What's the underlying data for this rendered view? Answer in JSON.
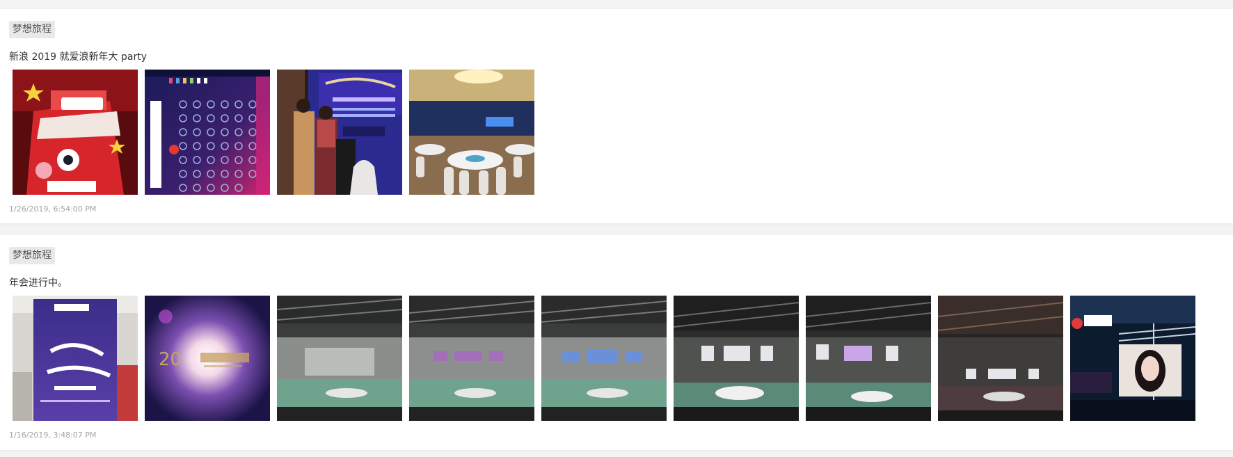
{
  "posts": [
    {
      "tag": "梦想旅程",
      "text": "新浪 2019 就爱浪新年大 party",
      "timestamp": "1/26/2019, 6:54:00 PM",
      "photos": [
        {
          "name": "cake-photo"
        },
        {
          "name": "seating-chart-photo"
        },
        {
          "name": "signin-backdrop-photo"
        },
        {
          "name": "banquet-hall-photo"
        }
      ]
    },
    {
      "tag": "梦想旅程",
      "text": "年会进行中。",
      "timestamp": "1/16/2019, 3:48:07 PM",
      "photos": [
        {
          "name": "annual-meeting-poster-photo"
        },
        {
          "name": "20th-anniversary-poster-photo"
        },
        {
          "name": "arena-stage-photo-1"
        },
        {
          "name": "arena-stage-photo-2"
        },
        {
          "name": "arena-stage-photo-3"
        },
        {
          "name": "arena-stage-photo-4"
        },
        {
          "name": "arena-stage-photo-5"
        },
        {
          "name": "arena-stage-photo-6"
        },
        {
          "name": "weibo-screen-photo"
        }
      ]
    }
  ]
}
